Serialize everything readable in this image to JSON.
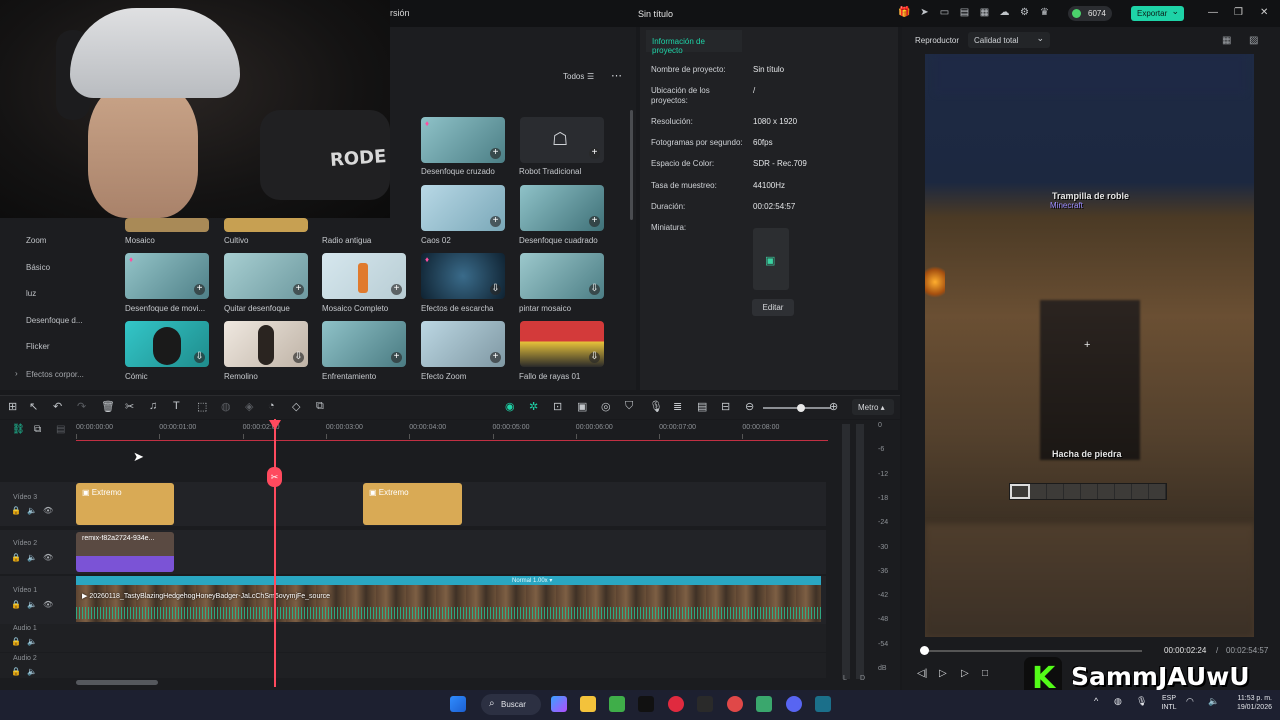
{
  "titlebar": {
    "menu_fragment": "rsión",
    "document_title": "Sin título",
    "credits": "6074",
    "export_label": "Exportar",
    "icons": [
      "gift-icon",
      "send-icon",
      "monitor-icon",
      "save-icon",
      "layout-icon",
      "cloud-icon",
      "settings-icon",
      "crown-icon"
    ]
  },
  "webcam": {
    "mic_brand": "RODE"
  },
  "effects": {
    "filter_label": "Todos",
    "categories": [
      "Zoom",
      "Básico",
      "luz",
      "Desenfoque d...",
      "Flicker"
    ],
    "more_label": "Efectos corpor...",
    "tiles": [
      {
        "label": "Desenfoque cruzado",
        "premium": true
      },
      {
        "label": "Robot Tradicional",
        "premium": false
      },
      {
        "label": "Mosaico",
        "premium": false
      },
      {
        "label": "Cultivo",
        "premium": false
      },
      {
        "label": "Radio antigua",
        "premium": false
      },
      {
        "label": "Caos 02",
        "premium": false
      },
      {
        "label": "Desenfoque cuadrado",
        "premium": false
      },
      {
        "label": "Desenfoque de movi...",
        "premium": true
      },
      {
        "label": "Quitar desenfoque",
        "premium": false
      },
      {
        "label": "Mosaico Completo",
        "premium": false
      },
      {
        "label": "Efectos de escarcha",
        "premium": true
      },
      {
        "label": "pintar mosaico",
        "premium": false
      },
      {
        "label": "Cómic",
        "premium": false
      },
      {
        "label": "Remolino",
        "premium": false
      },
      {
        "label": "Enfrentamiento",
        "premium": false
      },
      {
        "label": "Efecto Zoom",
        "premium": false
      },
      {
        "label": "Fallo de rayas 01",
        "premium": false
      }
    ]
  },
  "project_info": {
    "tab_label": "Información de proyecto",
    "rows": [
      {
        "label": "Nombre de proyecto:",
        "value": "Sin título"
      },
      {
        "label": "Ubicación de los proyectos:",
        "value": "/"
      },
      {
        "label": "Resolución:",
        "value": "1080 x 1920"
      },
      {
        "label": "Fotogramas por segundo:",
        "value": "60fps"
      },
      {
        "label": "Espacio de Color:",
        "value": "SDR - Rec.709"
      },
      {
        "label": "Tasa de muestreo:",
        "value": "44100Hz"
      },
      {
        "label": "Duración:",
        "value": "00:02:54:57"
      },
      {
        "label": "Miniatura:",
        "value": ""
      }
    ],
    "edit_label": "Editar"
  },
  "player": {
    "title": "Reproductor",
    "quality": "Calidad total",
    "caption_top": "Trampilla de roble",
    "caption_sub": "Minecraft",
    "caption_mid": "Hacha de piedra",
    "current_time": "00:00:02:24",
    "separator": "/",
    "total_time": "00:02:54:57",
    "progress_fraction": 0.014
  },
  "watermark": {
    "channel": "SammJAUwU"
  },
  "toolbar": {
    "metro_label": "Metro"
  },
  "timeline": {
    "ruler": [
      "00:00:00:00",
      "00:00:01:00",
      "00:00:02:00",
      "00:00:03:00",
      "00:00:04:00",
      "00:00:05:00",
      "00:00:06:00",
      "00:00:07:00",
      "00:00:08:00"
    ],
    "tracks": [
      {
        "name": "Vídeo 3"
      },
      {
        "name": "Vídeo 2"
      },
      {
        "name": "Vídeo 1"
      },
      {
        "name": "Audio 1"
      },
      {
        "name": "Audio 2"
      }
    ],
    "clips": {
      "text_a": "Extremo",
      "text_b": "Extremo",
      "media": "remix-f82a2724-934e...",
      "main": "20260118_TastyBlazingHedgehogHoneyBadger-JaLcChSm6ovymjFe_source",
      "speed": "Normal 1.00x"
    },
    "meter_labels": [
      "0",
      "-6",
      "-12",
      "-18",
      "-24",
      "-30",
      "-36",
      "-42",
      "-48",
      "-54",
      "dB"
    ],
    "meter_channels": [
      "L",
      "D"
    ]
  },
  "taskbar": {
    "search_label": "Buscar",
    "language": "ESP",
    "layout": "INTL",
    "time": "11:53 p. m.",
    "date": "19/01/2026"
  }
}
